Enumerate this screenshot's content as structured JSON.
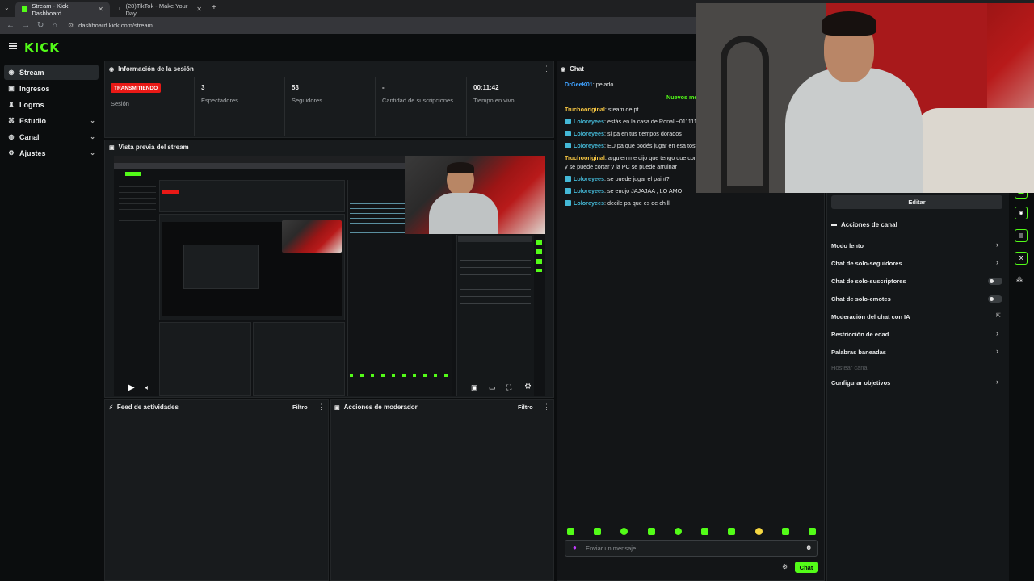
{
  "browser": {
    "tabs": [
      {
        "title": "Stream - Kick Dashboard",
        "active": true
      },
      {
        "title": "(28)TikTok - Make Your Day",
        "active": false
      }
    ],
    "url": "dashboard.kick.com/stream"
  },
  "logo": "KICK",
  "sidebar": {
    "items": [
      {
        "label": "Stream",
        "icon": "broadcast-icon",
        "active": true
      },
      {
        "label": "Ingresos",
        "icon": "wallet-icon"
      },
      {
        "label": "Logros",
        "icon": "trophy-icon"
      },
      {
        "label": "Estudio",
        "icon": "studio-icon",
        "expandable": true
      },
      {
        "label": "Canal",
        "icon": "channel-icon",
        "expandable": true
      },
      {
        "label": "Ajustes",
        "icon": "gear-icon",
        "expandable": true
      }
    ]
  },
  "session": {
    "title": "Información de la sesión",
    "status_badge": "TRANSMITIENDO",
    "status_label": "Sesión",
    "stats": [
      {
        "value": "3",
        "label": "Espectadores"
      },
      {
        "value": "53",
        "label": "Seguidores"
      },
      {
        "value": "-",
        "label": "Cantidad de suscripciones"
      },
      {
        "value": "00:11:42",
        "label": "Tiempo en vivo"
      }
    ]
  },
  "preview": {
    "title": "Vista previa del stream"
  },
  "activity_feed": {
    "title": "Feed de actividades",
    "filter": "Filtro"
  },
  "mod_actions": {
    "title": "Acciones de moderador",
    "filter": "Filtro"
  },
  "chat": {
    "title": "Chat",
    "new_messages": "Nuevos me",
    "messages": [
      {
        "user": "DrGeeK01",
        "color": "#3fa1ff",
        "verified": false,
        "text": ": pelado"
      },
      {
        "user": "Truchooriginal",
        "color": "#f5c542",
        "verified": false,
        "text": ": steam de pt"
      },
      {
        "user": "Loloreyees",
        "color": "#44b8d6",
        "verified": true,
        "text": ": estás en la casa de Ronal ~0111111000"
      },
      {
        "user": "Loloreyees",
        "color": "#44b8d6",
        "verified": true,
        "text": ": si pa en tus tiempos dorados"
      },
      {
        "user": "Loloreyees",
        "color": "#44b8d6",
        "verified": true,
        "text": ": EU pa que podés jugar en esa tostadi"
      },
      {
        "user": "Truchooriginal",
        "color": "#f5c542",
        "verified": false,
        "text": ": alguien me dijo que tengo que compr"
      },
      {
        "user": "",
        "color": "#e2e4e5",
        "verified": false,
        "text": "y se puede cortar y la PC se puede arruinar"
      },
      {
        "user": "Loloreyees",
        "color": "#44b8d6",
        "verified": true,
        "text": ": se puede jugar el paint?"
      },
      {
        "user": "Loloreyees",
        "color": "#44b8d6",
        "verified": true,
        "text": ": se enojo JAJAJAA , LO AMO"
      },
      {
        "user": "Loloreyees",
        "color": "#44b8d6",
        "verified": true,
        "text": ": decile pa que es de chill"
      }
    ],
    "input_placeholder": "Enviar un mensaje",
    "send_label": "Chat"
  },
  "channel_actions": {
    "edit_label": "Editar",
    "title": "Acciones de canal",
    "items": [
      {
        "label": "Modo lento",
        "control": "chevron"
      },
      {
        "label": "Chat de solo-seguidores",
        "control": "chevron"
      },
      {
        "label": "Chat de solo-suscriptores",
        "control": "toggle"
      },
      {
        "label": "Chat de solo-emotes",
        "control": "toggle"
      },
      {
        "label": "Moderación del chat con IA",
        "control": "external"
      },
      {
        "label": "Restricción de edad",
        "control": "chevron"
      },
      {
        "label": "Palabras baneadas",
        "control": "chevron"
      },
      {
        "label": "Hostear canal",
        "control": "disabled"
      },
      {
        "label": "Configurar objetivos",
        "control": "chevron"
      }
    ]
  },
  "colors": {
    "brand": "#53fc18",
    "live": "#e91916",
    "panel": "#181b1d"
  }
}
